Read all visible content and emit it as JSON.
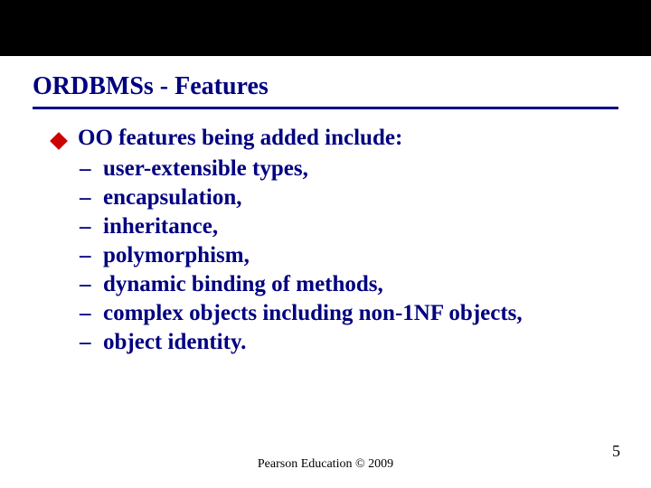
{
  "slide": {
    "title": "ORDBMSs - Features",
    "lead": "OO features being added include:",
    "dash": "–",
    "items": [
      "user-extensible types,",
      "encapsulation,",
      "inheritance,",
      "polymorphism,",
      "dynamic binding of methods,",
      "complex objects including non-1NF objects,",
      "object identity."
    ],
    "footer": "Pearson Education © 2009",
    "page": "5"
  }
}
